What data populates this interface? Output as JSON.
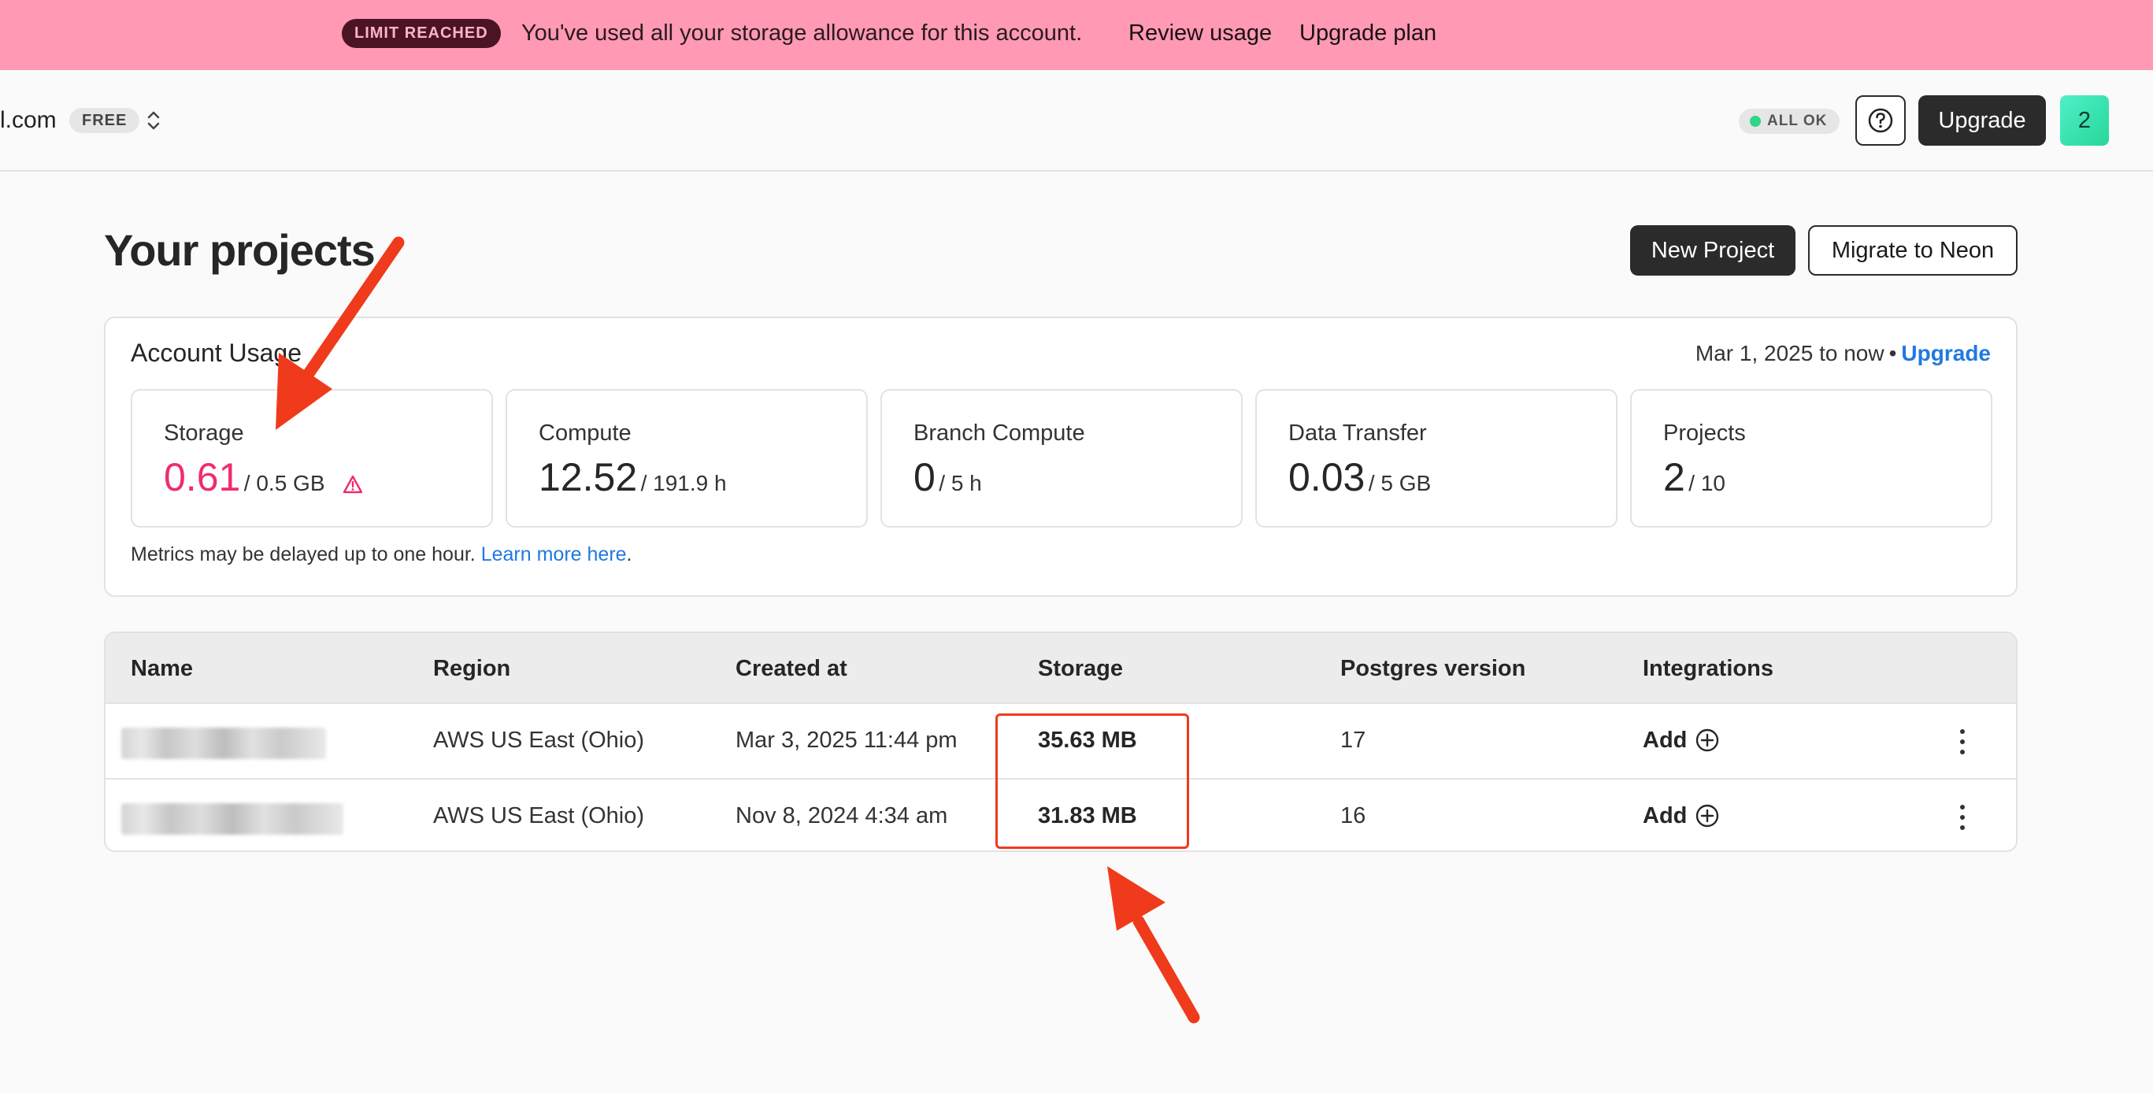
{
  "banner": {
    "badge": "LIMIT REACHED",
    "message": "You've used all your storage allowance for this account.",
    "review_link": "Review usage",
    "upgrade_link": "Upgrade plan",
    "bg_color": "#ff99b4"
  },
  "header": {
    "org_name": "l.com",
    "plan_badge": "FREE",
    "status": "ALL OK",
    "upgrade_label": "Upgrade",
    "avatar_label": "2",
    "icons": [
      "chevron-updown-icon",
      "help-icon"
    ]
  },
  "page": {
    "title": "Your projects",
    "new_project_label": "New Project",
    "migrate_label": "Migrate to Neon"
  },
  "usage": {
    "title": "Account Usage",
    "range": "Mar 1, 2025 to now",
    "separator": "•",
    "upgrade_link": "Upgrade",
    "metrics": [
      {
        "label": "Storage",
        "value": "0.61",
        "limit": "/ 0.5 GB",
        "alert": true
      },
      {
        "label": "Compute",
        "value": "12.52",
        "limit": "/ 191.9 h"
      },
      {
        "label": "Branch Compute",
        "value": "0",
        "limit": "/ 5 h"
      },
      {
        "label": "Data Transfer",
        "value": "0.03",
        "limit": "/ 5 GB"
      },
      {
        "label": "Projects",
        "value": "2",
        "limit": "/ 10"
      }
    ],
    "note": "Metrics may be delayed up to one hour.",
    "note_link": "Learn more here",
    "note_end": ".",
    "alert_color": "#ef2d6b"
  },
  "table": {
    "columns": [
      "Name",
      "Region",
      "Created at",
      "Storage",
      "Postgres version",
      "Integrations"
    ],
    "rows": [
      {
        "region": "AWS US East (Ohio)",
        "created": "Mar 3, 2025 11:44 pm",
        "storage": "35.63 MB",
        "pg": "17",
        "integrations": "Add"
      },
      {
        "region": "AWS US East (Ohio)",
        "created": "Nov 8, 2024 4:34 am",
        "storage": "31.83 MB",
        "pg": "16",
        "integrations": "Add"
      }
    ]
  },
  "annotation_color": "#f03a1c"
}
